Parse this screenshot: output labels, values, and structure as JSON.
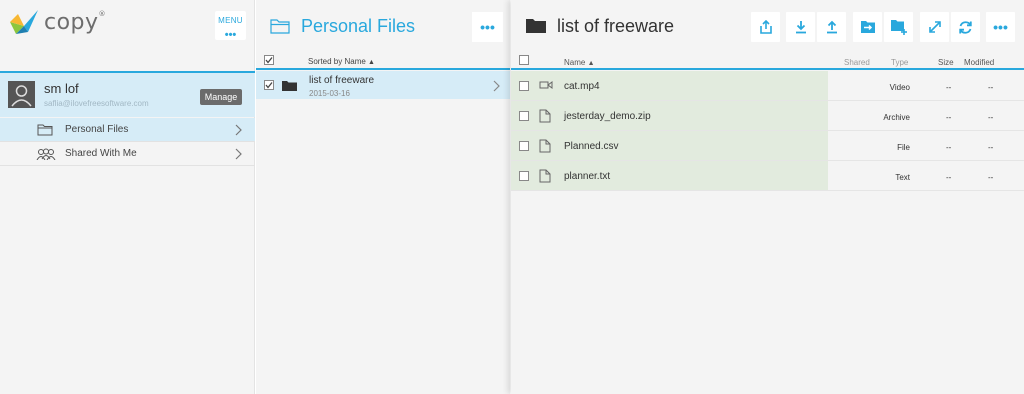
{
  "app": {
    "logo_text": "copy",
    "logo_mark": "®",
    "menu_label": "MENU",
    "menu_dots": "•••"
  },
  "user": {
    "name": "sm lof",
    "email": "saflia@ilovefreesoftware.com",
    "manage_label": "Manage"
  },
  "nav": {
    "items": [
      {
        "label": "Personal Files",
        "icon": "folder-icon",
        "active": true
      },
      {
        "label": "Shared With Me",
        "icon": "people-icon",
        "active": false
      }
    ]
  },
  "middle": {
    "title": "Personal Files",
    "more": "•••",
    "sort_label": "Sorted by Name",
    "rows": [
      {
        "name": "list of freeware",
        "date": "2015-03-16",
        "checked": true
      }
    ]
  },
  "right": {
    "title": "list of freeware",
    "more": "•••",
    "toolbar_icons": [
      "share-icon",
      "download-icon",
      "upload-icon",
      "move-icon",
      "new-folder-icon",
      "expand-icon",
      "refresh-icon",
      "more-icon"
    ],
    "columns": {
      "name": "Name",
      "shared": "Shared",
      "type": "Type",
      "size": "Size",
      "modified": "Modified"
    },
    "files": [
      {
        "name": "cat.mp4",
        "type": "Video",
        "size": "--",
        "modified": "--",
        "icon": "video-icon"
      },
      {
        "name": "jesterday_demo.zip",
        "type": "Archive",
        "size": "--",
        "modified": "--",
        "icon": "file-icon"
      },
      {
        "name": "Planned.csv",
        "type": "File",
        "size": "--",
        "modified": "--",
        "icon": "file-icon"
      },
      {
        "name": "planner.txt",
        "type": "Text",
        "size": "--",
        "modified": "--",
        "icon": "file-icon"
      }
    ]
  },
  "colors": {
    "accent": "#29a8dd",
    "selected_bg": "#d6ecf7",
    "row_highlight": "#e2ebde",
    "pane_bg": "#f4f4f4"
  }
}
